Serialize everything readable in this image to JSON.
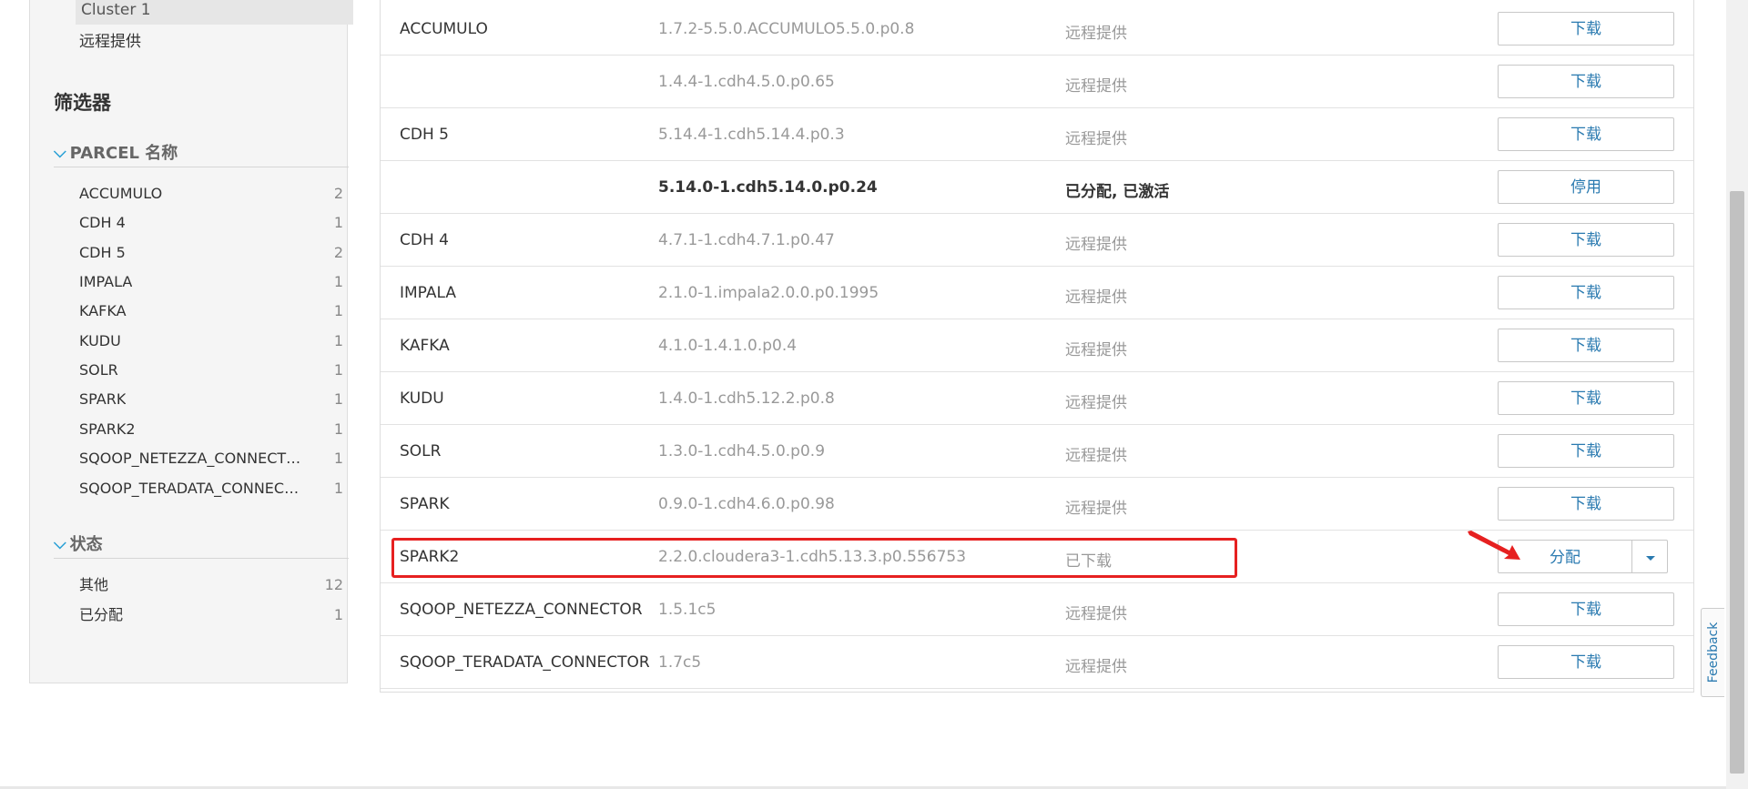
{
  "sidebar": {
    "cluster_label": "Cluster 1",
    "remote_label": "远程提供",
    "filters_title": "筛选器",
    "parcel_section_title": "PARCEL 名称",
    "parcel_filters": [
      {
        "name": "ACCUMULO",
        "count": "2"
      },
      {
        "name": "CDH 4",
        "count": "1"
      },
      {
        "name": "CDH 5",
        "count": "2"
      },
      {
        "name": "IMPALA",
        "count": "1"
      },
      {
        "name": "KAFKA",
        "count": "1"
      },
      {
        "name": "KUDU",
        "count": "1"
      },
      {
        "name": "SOLR",
        "count": "1"
      },
      {
        "name": "SPARK",
        "count": "1"
      },
      {
        "name": "SPARK2",
        "count": "1"
      },
      {
        "name": "SQOOP_NETEZZA_CONNECTOR",
        "count": "1"
      },
      {
        "name": "SQOOP_TERADATA_CONNECTOR",
        "count": "1"
      }
    ],
    "status_section_title": "状态",
    "status_filters": [
      {
        "name": "其他",
        "count": "12"
      },
      {
        "name": "已分配",
        "count": "1"
      }
    ]
  },
  "parcels": [
    {
      "name": "ACCUMULO",
      "version": "1.7.2-5.5.0.ACCUMULO5.5.0.p0.8",
      "status": "远程提供",
      "action": "下载"
    },
    {
      "name": "",
      "version": "1.4.4-1.cdh4.5.0.p0.65",
      "status": "远程提供",
      "action": "下载"
    },
    {
      "name": "CDH 5",
      "version": "5.14.4-1.cdh5.14.4.p0.3",
      "status": "远程提供",
      "action": "下载"
    },
    {
      "name": "",
      "version": "5.14.0-1.cdh5.14.0.p0.24",
      "status": "已分配, 已激活",
      "action": "停用"
    },
    {
      "name": "CDH 4",
      "version": "4.7.1-1.cdh4.7.1.p0.47",
      "status": "远程提供",
      "action": "下载"
    },
    {
      "name": "IMPALA",
      "version": "2.1.0-1.impala2.0.0.p0.1995",
      "status": "远程提供",
      "action": "下载"
    },
    {
      "name": "KAFKA",
      "version": "4.1.0-1.4.1.0.p0.4",
      "status": "远程提供",
      "action": "下载"
    },
    {
      "name": "KUDU",
      "version": "1.4.0-1.cdh5.12.2.p0.8",
      "status": "远程提供",
      "action": "下载"
    },
    {
      "name": "SOLR",
      "version": "1.3.0-1.cdh4.5.0.p0.9",
      "status": "远程提供",
      "action": "下载"
    },
    {
      "name": "SPARK",
      "version": "0.9.0-1.cdh4.6.0.p0.98",
      "status": "远程提供",
      "action": "下载"
    },
    {
      "name": "SPARK2",
      "version": "2.2.0.cloudera3-1.cdh5.13.3.p0.556753",
      "status": "已下载",
      "action": "分配"
    },
    {
      "name": "SQOOP_NETEZZA_CONNECTOR",
      "version": "1.5.1c5",
      "status": "远程提供",
      "action": "下载"
    },
    {
      "name": "SQOOP_TERADATA_CONNECTOR",
      "version": "1.7c5",
      "status": "远程提供",
      "action": "下载"
    }
  ],
  "feedback_label": "Feedback",
  "colors": {
    "link_blue": "#2a7ab0",
    "chevron_blue": "#29a0d6",
    "highlight_red": "#e62020"
  }
}
